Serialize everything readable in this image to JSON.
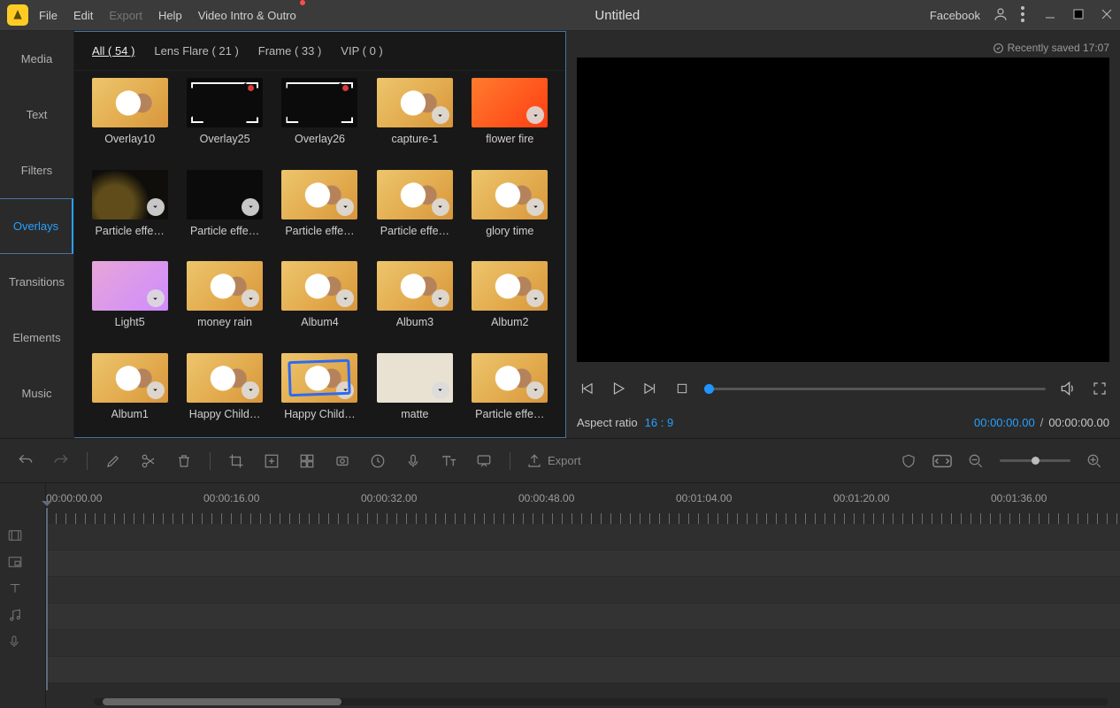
{
  "menubar": {
    "items": [
      "File",
      "Edit",
      "Export",
      "Help",
      "Video Intro & Outro"
    ],
    "disabled_index": 2,
    "has_dot_after_index": 4,
    "title": "Untitled",
    "right_label": "Facebook"
  },
  "sidebar": {
    "tabs": [
      "Media",
      "Text",
      "Filters",
      "Overlays",
      "Transitions",
      "Elements",
      "Music"
    ],
    "active": "Overlays"
  },
  "library": {
    "filters": [
      {
        "label": "All ( 54 )",
        "active": true
      },
      {
        "label": "Lens Flare ( 21 )"
      },
      {
        "label": "Frame ( 33 )"
      },
      {
        "label": "VIP ( 0 )"
      }
    ],
    "items": [
      {
        "label": "Overlay10",
        "style": "cat",
        "no_dl": true
      },
      {
        "label": "Overlay25",
        "style": "dark frame-corners",
        "rec": true,
        "no_dl": true
      },
      {
        "label": "Overlay26",
        "style": "dark frame-corners",
        "rec": true,
        "no_dl": true
      },
      {
        "label": "capture-1",
        "style": "cat"
      },
      {
        "label": "flower fire",
        "style": "orange-fire"
      },
      {
        "label": "Particle effe…",
        "style": "dusty"
      },
      {
        "label": "Particle effe…",
        "style": "dark"
      },
      {
        "label": "Particle effe…",
        "style": "cat"
      },
      {
        "label": "Particle effe…",
        "style": "cat"
      },
      {
        "label": "glory time",
        "style": "cat"
      },
      {
        "label": "Light5",
        "style": "pinkish"
      },
      {
        "label": "money rain",
        "style": "cat"
      },
      {
        "label": "Album4",
        "style": "cat"
      },
      {
        "label": "Album3",
        "style": "cat"
      },
      {
        "label": "Album2",
        "style": "cat"
      },
      {
        "label": "Album1",
        "style": "cat"
      },
      {
        "label": "Happy Child…",
        "style": "cat"
      },
      {
        "label": "Happy Child…",
        "style": "cat blue-frame"
      },
      {
        "label": "matte",
        "style": "pale"
      },
      {
        "label": "Particle effe…",
        "style": "cat"
      }
    ]
  },
  "preview": {
    "saved": "Recently saved 17:07",
    "aspect_label": "Aspect ratio",
    "aspect_value": "16 : 9",
    "time_current": "00:00:00.00",
    "time_sep": "/",
    "time_total": "00:00:00.00"
  },
  "toolbar": {
    "export_label": "Export"
  },
  "timeline": {
    "marks": [
      {
        "pos": 0,
        "label": "00:00:00.00"
      },
      {
        "pos": 178,
        "label": "00:00:16.00"
      },
      {
        "pos": 356,
        "label": "00:00:32.00"
      },
      {
        "pos": 534,
        "label": "00:00:48.00"
      },
      {
        "pos": 712,
        "label": "00:01:04.00"
      },
      {
        "pos": 890,
        "label": "00:01:20.00"
      },
      {
        "pos": 1068,
        "label": "00:01:36.00"
      }
    ]
  }
}
